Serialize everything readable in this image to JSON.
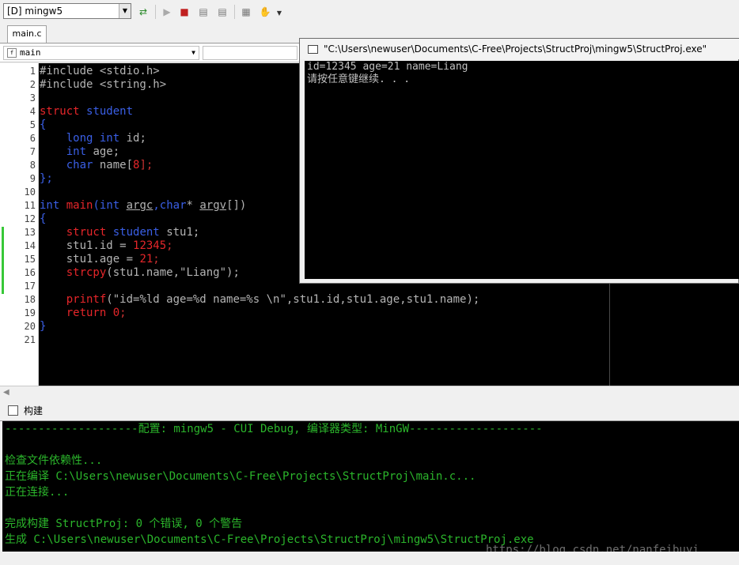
{
  "toolbar": {
    "config_combo": "[D] mingw5",
    "icons": [
      "rebuild-icon",
      "run-icon",
      "stop-icon",
      "step-icon",
      "step-over-icon",
      "debug-icon",
      "hand-icon"
    ]
  },
  "tabs": [
    {
      "label": "main.c"
    }
  ],
  "function_selector": {
    "value": "main"
  },
  "editor": {
    "line_numbers": [
      "1",
      "2",
      "3",
      "4",
      "5",
      "6",
      "7",
      "8",
      "9",
      "10",
      "11",
      "12",
      "13",
      "14",
      "15",
      "16",
      "17",
      "18",
      "19",
      "20",
      "21"
    ],
    "code": {
      "l1": "#include <stdio.h>",
      "l2": "#include <string.h>",
      "l4a": "struct",
      "l4b": "student",
      "l5": "{",
      "l6a": "long",
      "l6b": "int",
      "l6c": "id;",
      "l7a": "int",
      "l7b": "age;",
      "l8a": "char",
      "l8b": "name[",
      "l8c": "8",
      "l8d": "];",
      "l9": "};",
      "l11a": "int",
      "l11b": "main",
      "l11c": "(",
      "l11d": "int",
      "l11e": "argc",
      "l11f": ",",
      "l11g": "char",
      "l11h": "* ",
      "l11i": "argv",
      "l11j": "[])",
      "l12": "{",
      "l13a": "struct",
      "l13b": "student",
      "l13c": "stu1;",
      "l14a": "stu1.id = ",
      "l14b": "12345",
      "l14c": ";",
      "l15a": "stu1.age = ",
      "l15b": "21",
      "l15c": ";",
      "l16a": "strcpy",
      "l16b": "(stu1.name,\"Liang\");",
      "l18a": "printf",
      "l18b": "(\"id=%ld age=%d name=%s \\n\",stu1.id,stu1.age,stu1.name);",
      "l19a": "return",
      "l19b": "0",
      "l19c": ";",
      "l20": "}"
    }
  },
  "console": {
    "title": "\"C:\\Users\\newuser\\Documents\\C-Free\\Projects\\StructProj\\mingw5\\StructProj.exe\"",
    "lines": [
      "id=12345 age=21 name=Liang",
      "请按任意键继续. . ."
    ]
  },
  "build_pane": {
    "title": "构建",
    "lines": [
      "--------------------配置: mingw5 - CUI Debug, 编译器类型: MinGW--------------------",
      "",
      "检查文件依赖性...",
      "正在编译 C:\\Users\\newuser\\Documents\\C-Free\\Projects\\StructProj\\main.c...",
      "正在连接...",
      "",
      "完成构建 StructProj: 0 个错误, 0 个警告",
      "生成 C:\\Users\\newuser\\Documents\\C-Free\\Projects\\StructProj\\mingw5\\StructProj.exe"
    ],
    "watermark": "https://blog.csdn.net/nanfeibuyi"
  }
}
